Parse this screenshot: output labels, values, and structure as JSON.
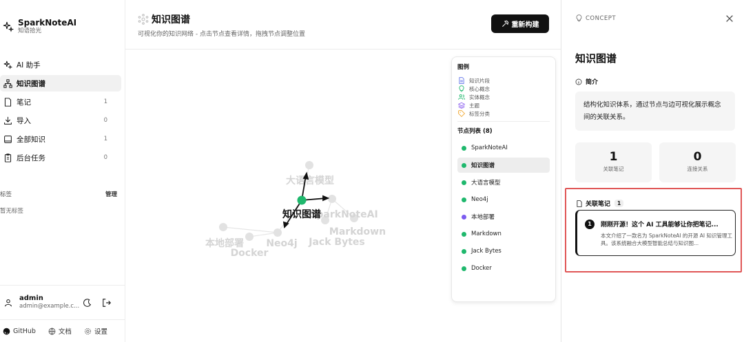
{
  "brand": {
    "name": "SparkNoteAI",
    "subtitle": "知语拾光"
  },
  "nav": [
    {
      "label": "AI 助手",
      "count": ""
    },
    {
      "label": "知识图谱",
      "count": ""
    },
    {
      "label": "笔记",
      "count": "1"
    },
    {
      "label": "导入",
      "count": "0"
    },
    {
      "label": "全部知识",
      "count": "1"
    },
    {
      "label": "后台任务",
      "count": "0"
    }
  ],
  "tags": {
    "heading": "标签",
    "manage": "管理",
    "empty": "暂无标签"
  },
  "user": {
    "name": "admin",
    "email": "admin@example.c..."
  },
  "footer": {
    "github": "GitHub",
    "docs": "文档",
    "settings": "设置"
  },
  "header": {
    "title": "知识图谱",
    "description": "可视化你的知识网络 - 点击节点查看详情，拖拽节点调整位置",
    "rebuild": "重新构建"
  },
  "graph_labels": {
    "llm": "大语言模型",
    "kg": "知识图谱",
    "spark": "SparkNoteAI",
    "markdown": "Markdown",
    "jack": "Jack Bytes",
    "neo4j": "Neo4j",
    "local": "本地部署",
    "docker": "Docker"
  },
  "legend": {
    "title": "图例",
    "items": [
      "知识片段",
      "核心概念",
      "实体概念",
      "主题",
      "标签分类"
    ]
  },
  "node_list": {
    "title": "节点列表 (8)",
    "items": [
      {
        "label": "SparkNoteAI",
        "color": "#1fb86d"
      },
      {
        "label": "知识图谱",
        "color": "#1fb86d"
      },
      {
        "label": "大语言模型",
        "color": "#1fb86d"
      },
      {
        "label": "Neo4j",
        "color": "#1fb86d"
      },
      {
        "label": "本地部署",
        "color": "#7c5cf0"
      },
      {
        "label": "Markdown",
        "color": "#1fb86d"
      },
      {
        "label": "Jack Bytes",
        "color": "#1fb86d"
      },
      {
        "label": "Docker",
        "color": "#1fb86d"
      }
    ]
  },
  "concept": {
    "tag": "CONCEPT",
    "title": "知识图谱",
    "intro_heading": "简介",
    "intro": "结构化知识体系，通过节点与边可视化展示概念间的关联关系。",
    "stats": [
      {
        "value": "1",
        "label": "关联笔记"
      },
      {
        "value": "0",
        "label": "连接关系"
      }
    ],
    "related_heading": "关联笔记",
    "related_count": "1",
    "note": {
      "index": "1",
      "title": "刚刚开源！这个 AI 工具能够让你把笔记...",
      "desc": "本文介绍了一款名为 SparkNoteAI 的开源 AI 知识管理工具。该系统融合大模型智能总结与知识图..."
    }
  },
  "colors": {
    "accent": "#1fb86d",
    "purple": "#7c5cf0",
    "highlight": "#e05555"
  }
}
